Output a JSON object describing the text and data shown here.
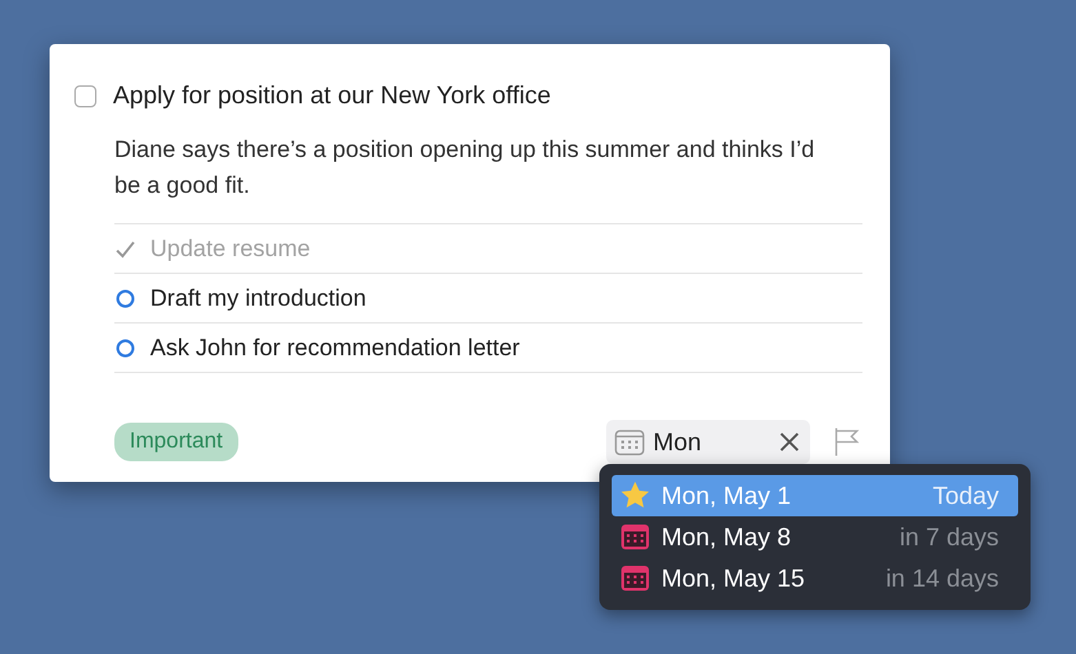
{
  "task": {
    "checked": false,
    "title": "Apply for position at our New York office",
    "note": "Diane says there’s a position opening up this summer and thinks I’d be a good fit.",
    "checklist": [
      {
        "text": "Update resume",
        "done": true
      },
      {
        "text": "Draft my introduction",
        "done": false
      },
      {
        "text": "Ask John for recommendation letter",
        "done": false
      }
    ],
    "tag": {
      "label": "Important"
    },
    "date_field": {
      "value": "Mon"
    }
  },
  "suggestions": [
    {
      "kind": "today",
      "date": "Mon, May 1",
      "relative": "Today",
      "selected": true
    },
    {
      "kind": "date",
      "date": "Mon, May 8",
      "relative": "in 7 days",
      "selected": false
    },
    {
      "kind": "date",
      "date": "Mon, May 15",
      "relative": "in 14 days",
      "selected": false
    }
  ]
}
